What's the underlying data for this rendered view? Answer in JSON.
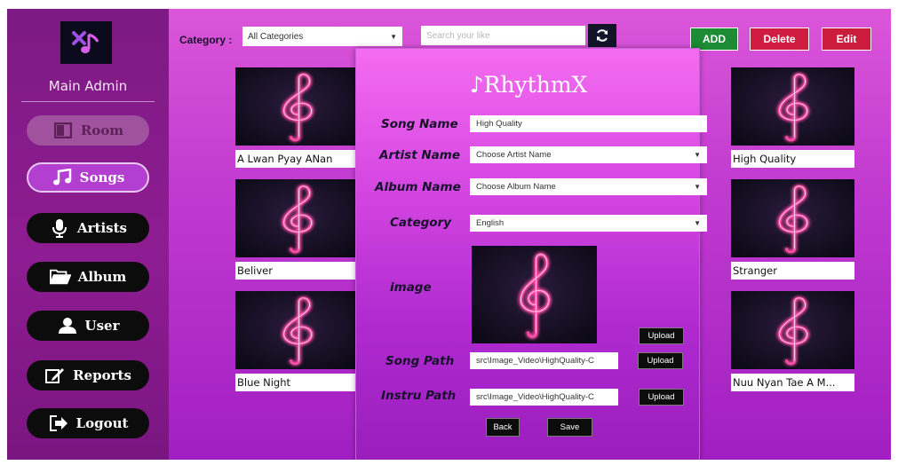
{
  "sidebar": {
    "role": "Main Admin",
    "nav": [
      {
        "label": "Room",
        "icon": "room-icon",
        "state": "disabled"
      },
      {
        "label": "Songs",
        "icon": "music-note-icon",
        "state": "active"
      },
      {
        "label": "Artists",
        "icon": "microphone-icon",
        "state": "normal"
      },
      {
        "label": "Album",
        "icon": "folder-icon",
        "state": "normal"
      },
      {
        "label": "User",
        "icon": "user-icon",
        "state": "normal"
      },
      {
        "label": "Reports",
        "icon": "edit-icon",
        "state": "normal"
      },
      {
        "label": "Logout",
        "icon": "logout-icon",
        "state": "normal"
      }
    ]
  },
  "toolbar": {
    "category_label": "Category :",
    "category_value": "All Categories",
    "search_placeholder": "Search your like",
    "add_label": "ADD",
    "delete_label": "Delete",
    "edit_label": "Edit"
  },
  "cards": [
    {
      "title": "A Lwan Pyay ANan"
    },
    {
      "title": "Beliver"
    },
    {
      "title": "Blue Night"
    },
    {
      "title": "High Quality"
    },
    {
      "title": "Stranger"
    },
    {
      "title": "Nuu Nyan Tae A M..."
    }
  ],
  "modal": {
    "title": "♪RhythmX",
    "song_name_label": "Song Name",
    "song_name_value": "High Quality",
    "artist_label": "Artist Name",
    "artist_value": "Choose Artist Name",
    "album_label": "Album Name",
    "album_value": "Choose Album Name",
    "category_label": "Category",
    "category_value": "English",
    "image_label": "image",
    "upload_label": "Upload",
    "song_path_label": "Song Path",
    "song_path_value": "src\\Image_Video\\HighQuality-C",
    "instru_path_label": "Instru Path",
    "instru_path_value": "src\\Image_Video\\HighQuality-C",
    "back_label": "Back",
    "save_label": "Save"
  },
  "colors": {
    "sidebar": "#8e1c92",
    "main_gradient_top": "#db56d9",
    "main_gradient_bottom": "#a11fc2",
    "add": "#1d8a34",
    "delete": "#d01c40",
    "neon": "#ff4fa8"
  }
}
